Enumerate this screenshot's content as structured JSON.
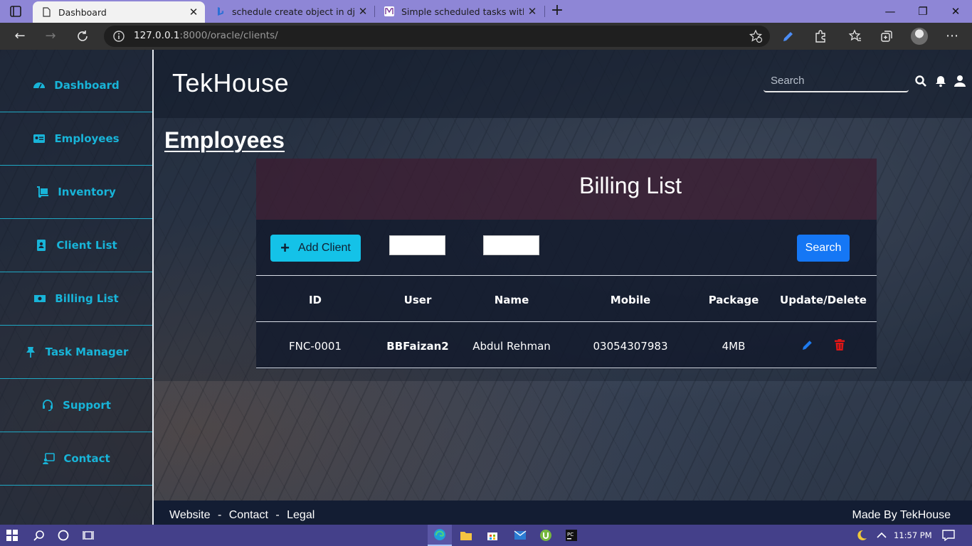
{
  "browser": {
    "tabs": [
      {
        "title": "Dashboard",
        "active": true
      },
      {
        "title": "schedule create object in django",
        "active": false
      },
      {
        "title": "Simple scheduled tasks with Djan",
        "active": false
      }
    ],
    "url_host": "127.0.0.1",
    "url_rest": ":8000/oracle/clients/",
    "new_tab_label": "+",
    "win_min": "—",
    "win_max": "❐",
    "win_close": "✕"
  },
  "sidebar": {
    "items": [
      {
        "label": "Dashboard",
        "icon": "dashboard-icon"
      },
      {
        "label": "Employees",
        "icon": "id-card-icon"
      },
      {
        "label": "Inventory",
        "icon": "dolly-icon"
      },
      {
        "label": "Client List",
        "icon": "address-book-icon"
      },
      {
        "label": "Billing List",
        "icon": "money-bill-icon"
      },
      {
        "label": "Task Manager",
        "icon": "thumbtack-icon"
      },
      {
        "label": "Support",
        "icon": "headset-icon"
      },
      {
        "label": "Contact",
        "icon": "contact-icon"
      }
    ],
    "accent": "#18b4d8"
  },
  "header": {
    "brand": "TekHouse",
    "search_placeholder": "Search"
  },
  "main": {
    "page_heading": "Employees",
    "card_title": "Billing List",
    "add_button": "Add Client",
    "search_button": "Search",
    "table": {
      "columns": [
        "ID",
        "User",
        "Name",
        "Mobile",
        "Package",
        "Update/Delete"
      ],
      "rows": [
        {
          "id": "FNC-0001",
          "user": "BBFaizan2",
          "name": "Abdul Rehman",
          "mobile": "03054307983",
          "package": "4MB"
        }
      ]
    }
  },
  "footer": {
    "links": [
      "Website",
      "Contact",
      "Legal"
    ],
    "separator": "-",
    "credit": "Made By TekHouse"
  },
  "taskbar": {
    "time": "11:57 PM"
  },
  "colors": {
    "add_button": "#14c2e8",
    "search_button": "#1577f5",
    "edit_icon": "#1e7bf0",
    "delete_icon": "#e01515"
  }
}
